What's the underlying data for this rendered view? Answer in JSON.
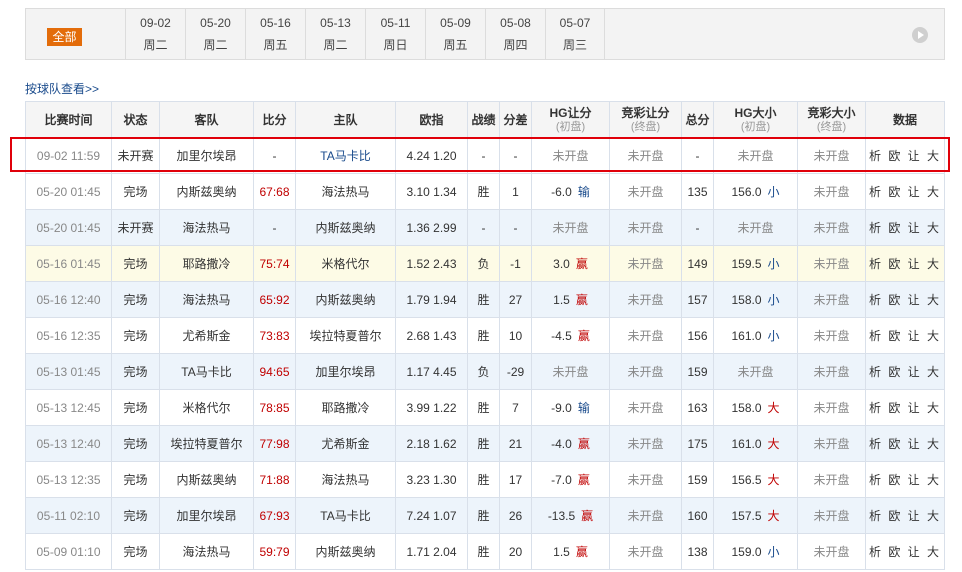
{
  "filter": {
    "all_label": "全部",
    "dates": [
      {
        "date": "09-02",
        "weekday": "周二"
      },
      {
        "date": "05-20",
        "weekday": "周二"
      },
      {
        "date": "05-16",
        "weekday": "周五"
      },
      {
        "date": "05-13",
        "weekday": "周二"
      },
      {
        "date": "05-11",
        "weekday": "周日"
      },
      {
        "date": "05-09",
        "weekday": "周五"
      },
      {
        "date": "05-08",
        "weekday": "周四"
      },
      {
        "date": "05-07",
        "weekday": "周三"
      }
    ]
  },
  "team_link": "按球队查看>>",
  "table": {
    "headers": [
      {
        "label": "比赛时间",
        "sub": ""
      },
      {
        "label": "状态",
        "sub": ""
      },
      {
        "label": "客队",
        "sub": ""
      },
      {
        "label": "比分",
        "sub": ""
      },
      {
        "label": "主队",
        "sub": ""
      },
      {
        "label": "欧指",
        "sub": ""
      },
      {
        "label": "战绩",
        "sub": ""
      },
      {
        "label": "分差",
        "sub": ""
      },
      {
        "label": "HG让分",
        "sub": "(初盘)"
      },
      {
        "label": "竞彩让分",
        "sub": "(终盘)"
      },
      {
        "label": "总分",
        "sub": ""
      },
      {
        "label": "HG大小",
        "sub": "(初盘)"
      },
      {
        "label": "竞彩大小",
        "sub": "(终盘)"
      },
      {
        "label": "数据",
        "sub": ""
      }
    ],
    "rows": [
      {
        "style": "white",
        "time": "09-02 11:59",
        "status": "未开赛",
        "away": "加里尔埃昂",
        "away_blue": false,
        "score": "-",
        "home": "TA马卡比",
        "home_blue": true,
        "odds": "4.24 1.20",
        "result": "-",
        "diff": "-",
        "hg_handicap": "未开盘",
        "hg_handicap_mark": "",
        "jc_handicap": "未开盘",
        "total": "-",
        "hg_ou": "未开盘",
        "hg_ou_mark": "",
        "jc_ou": "未开盘",
        "links": "析 欧 让 大"
      },
      {
        "style": "white",
        "time": "05-20 01:45",
        "status": "完场",
        "away": "内斯兹奥纳",
        "away_blue": false,
        "score": "67:68",
        "home": "海法热马",
        "home_blue": false,
        "odds": "3.10 1.34",
        "result": "胜",
        "diff": "1",
        "hg_handicap": "-6.0",
        "hg_handicap_mark": "输",
        "jc_handicap": "未开盘",
        "total": "135",
        "hg_ou": "156.0",
        "hg_ou_mark": "小",
        "jc_ou": "未开盘",
        "links": "析 欧 让 大"
      },
      {
        "style": "blue",
        "time": "05-20 01:45",
        "status": "未开赛",
        "away": "海法热马",
        "away_blue": false,
        "score": "-",
        "home": "内斯兹奥纳",
        "home_blue": false,
        "odds": "1.36 2.99",
        "result": "-",
        "diff": "-",
        "hg_handicap": "未开盘",
        "hg_handicap_mark": "",
        "jc_handicap": "未开盘",
        "total": "-",
        "hg_ou": "未开盘",
        "hg_ou_mark": "",
        "jc_ou": "未开盘",
        "links": "析 欧 让 大"
      },
      {
        "style": "yellow",
        "time": "05-16 01:45",
        "status": "完场",
        "away": "耶路撒冷",
        "away_blue": false,
        "score": "75:74",
        "home": "米格代尔",
        "home_blue": false,
        "odds": "1.52 2.43",
        "result": "负",
        "diff": "-1",
        "hg_handicap": "3.0",
        "hg_handicap_mark": "赢",
        "jc_handicap": "未开盘",
        "total": "149",
        "hg_ou": "159.5",
        "hg_ou_mark": "小",
        "jc_ou": "未开盘",
        "links": "析 欧 让 大"
      },
      {
        "style": "blue",
        "time": "05-16 12:40",
        "status": "完场",
        "away": "海法热马",
        "away_blue": false,
        "score": "65:92",
        "home": "内斯兹奥纳",
        "home_blue": false,
        "odds": "1.79 1.94",
        "result": "胜",
        "diff": "27",
        "hg_handicap": "1.5",
        "hg_handicap_mark": "赢",
        "jc_handicap": "未开盘",
        "total": "157",
        "hg_ou": "158.0",
        "hg_ou_mark": "小",
        "jc_ou": "未开盘",
        "links": "析 欧 让 大"
      },
      {
        "style": "white",
        "time": "05-16 12:35",
        "status": "完场",
        "away": "尤希斯金",
        "away_blue": false,
        "score": "73:83",
        "home": "埃拉特夏普尔",
        "home_blue": false,
        "odds": "2.68 1.43",
        "result": "胜",
        "diff": "10",
        "hg_handicap": "-4.5",
        "hg_handicap_mark": "赢",
        "jc_handicap": "未开盘",
        "total": "156",
        "hg_ou": "161.0",
        "hg_ou_mark": "小",
        "jc_ou": "未开盘",
        "links": "析 欧 让 大"
      },
      {
        "style": "blue",
        "time": "05-13 01:45",
        "status": "完场",
        "away": "TA马卡比",
        "away_blue": false,
        "score": "94:65",
        "home": "加里尔埃昂",
        "home_blue": false,
        "odds": "1.17 4.45",
        "result": "负",
        "diff": "-29",
        "hg_handicap": "未开盘",
        "hg_handicap_mark": "",
        "jc_handicap": "未开盘",
        "total": "159",
        "hg_ou": "未开盘",
        "hg_ou_mark": "",
        "jc_ou": "未开盘",
        "links": "析 欧 让 大"
      },
      {
        "style": "white",
        "time": "05-13 12:45",
        "status": "完场",
        "away": "米格代尔",
        "away_blue": false,
        "score": "78:85",
        "home": "耶路撒冷",
        "home_blue": false,
        "odds": "3.99 1.22",
        "result": "胜",
        "diff": "7",
        "hg_handicap": "-9.0",
        "hg_handicap_mark": "输",
        "jc_handicap": "未开盘",
        "total": "163",
        "hg_ou": "158.0",
        "hg_ou_mark": "大",
        "jc_ou": "未开盘",
        "links": "析 欧 让 大"
      },
      {
        "style": "blue",
        "time": "05-13 12:40",
        "status": "完场",
        "away": "埃拉特夏普尔",
        "away_blue": false,
        "score": "77:98",
        "home": "尤希斯金",
        "home_blue": false,
        "odds": "2.18 1.62",
        "result": "胜",
        "diff": "21",
        "hg_handicap": "-4.0",
        "hg_handicap_mark": "赢",
        "jc_handicap": "未开盘",
        "total": "175",
        "hg_ou": "161.0",
        "hg_ou_mark": "大",
        "jc_ou": "未开盘",
        "links": "析 欧 让 大"
      },
      {
        "style": "white",
        "time": "05-13 12:35",
        "status": "完场",
        "away": "内斯兹奥纳",
        "away_blue": false,
        "score": "71:88",
        "home": "海法热马",
        "home_blue": false,
        "odds": "3.23 1.30",
        "result": "胜",
        "diff": "17",
        "hg_handicap": "-7.0",
        "hg_handicap_mark": "赢",
        "jc_handicap": "未开盘",
        "total": "159",
        "hg_ou": "156.5",
        "hg_ou_mark": "大",
        "jc_ou": "未开盘",
        "links": "析 欧 让 大"
      },
      {
        "style": "blue",
        "time": "05-11 02:10",
        "status": "完场",
        "away": "加里尔埃昂",
        "away_blue": false,
        "score": "67:93",
        "home": "TA马卡比",
        "home_blue": false,
        "odds": "7.24 1.07",
        "result": "胜",
        "diff": "26",
        "hg_handicap": "-13.5",
        "hg_handicap_mark": "赢",
        "jc_handicap": "未开盘",
        "total": "160",
        "hg_ou": "157.5",
        "hg_ou_mark": "大",
        "jc_ou": "未开盘",
        "links": "析 欧 让 大"
      },
      {
        "style": "white",
        "time": "05-09 01:10",
        "status": "完场",
        "away": "海法热马",
        "away_blue": false,
        "score": "59:79",
        "home": "内斯兹奥纳",
        "home_blue": false,
        "odds": "1.71 2.04",
        "result": "胜",
        "diff": "20",
        "hg_handicap": "1.5",
        "hg_handicap_mark": "赢",
        "jc_handicap": "未开盘",
        "total": "138",
        "hg_ou": "159.0",
        "hg_ou_mark": "小",
        "jc_ou": "未开盘",
        "links": "析 欧 让 大"
      }
    ]
  },
  "colors": {
    "accent": "#e36c0a",
    "highlight": "#e0000a",
    "link_blue": "#1a4b8c",
    "score_red": "#c00000"
  }
}
